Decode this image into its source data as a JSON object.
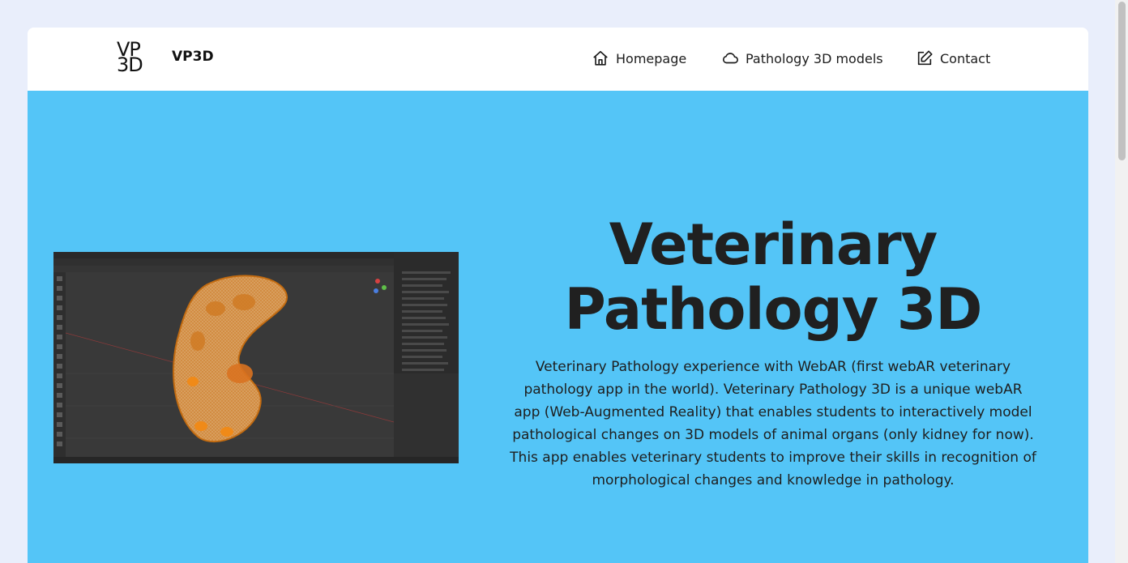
{
  "header": {
    "logo_line1": "VP",
    "logo_line2": "3D",
    "brand": "VP3D",
    "nav": [
      {
        "label": "Homepage",
        "icon": "home-icon"
      },
      {
        "label": "Pathology 3D models",
        "icon": "cloud-icon"
      },
      {
        "label": "Contact",
        "icon": "edit-icon"
      }
    ]
  },
  "hero": {
    "headline_line1": "Veterinary",
    "headline_line2": "Pathology 3D",
    "description": "Veterinary Pathology experience with WebAR (first webAR veterinary pathology app in the world). Veterinary Pathology 3D is a unique webAR app (Web-Augmented Reality) that enables students to interactively model pathological changes on 3D models of animal organs (only kidney for now). This app enables veterinary students to improve their skills in recognition of morphological changes and knowledge in pathology.",
    "image_subject": "screenshot of 3D modelling software showing a kidney mesh"
  },
  "colors": {
    "hero_background": "#54c5f7",
    "page_background": "#e9eefb",
    "text": "#202020"
  }
}
